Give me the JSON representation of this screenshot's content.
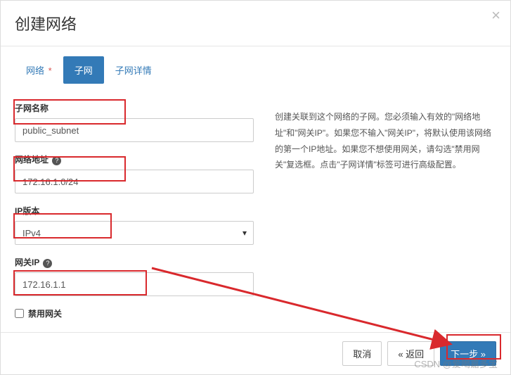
{
  "header": {
    "title": "创建网络"
  },
  "tabs": {
    "network": "网络",
    "subnet": "子网",
    "subnet_details": "子网详情",
    "required_mark": "*"
  },
  "form": {
    "subnet_name": {
      "label": "子网名称",
      "value": "public_subnet"
    },
    "network_address": {
      "label": "网络地址",
      "value": "172.16.1.0/24"
    },
    "ip_version": {
      "label": "IP版本",
      "value": "IPv4"
    },
    "gateway_ip": {
      "label": "网关IP",
      "value": "172.16.1.1"
    },
    "disable_gateway": {
      "label": "禁用网关"
    },
    "help_glyph": "?"
  },
  "help_text": "创建关联到这个网络的子网。您必须输入有效的\"网络地址\"和\"网关IP\"。如果您不输入\"网关IP\"，将默认使用该网络的第一个IP地址。如果您不想使用网关，请勾选\"禁用网关\"复选框。点击\"子网详情\"标签可进行高级配置。",
  "footer": {
    "cancel": "取消",
    "back": "« 返回",
    "next": "下一步 »"
  },
  "watermark": "CSDN @爱喝嘉多宝"
}
